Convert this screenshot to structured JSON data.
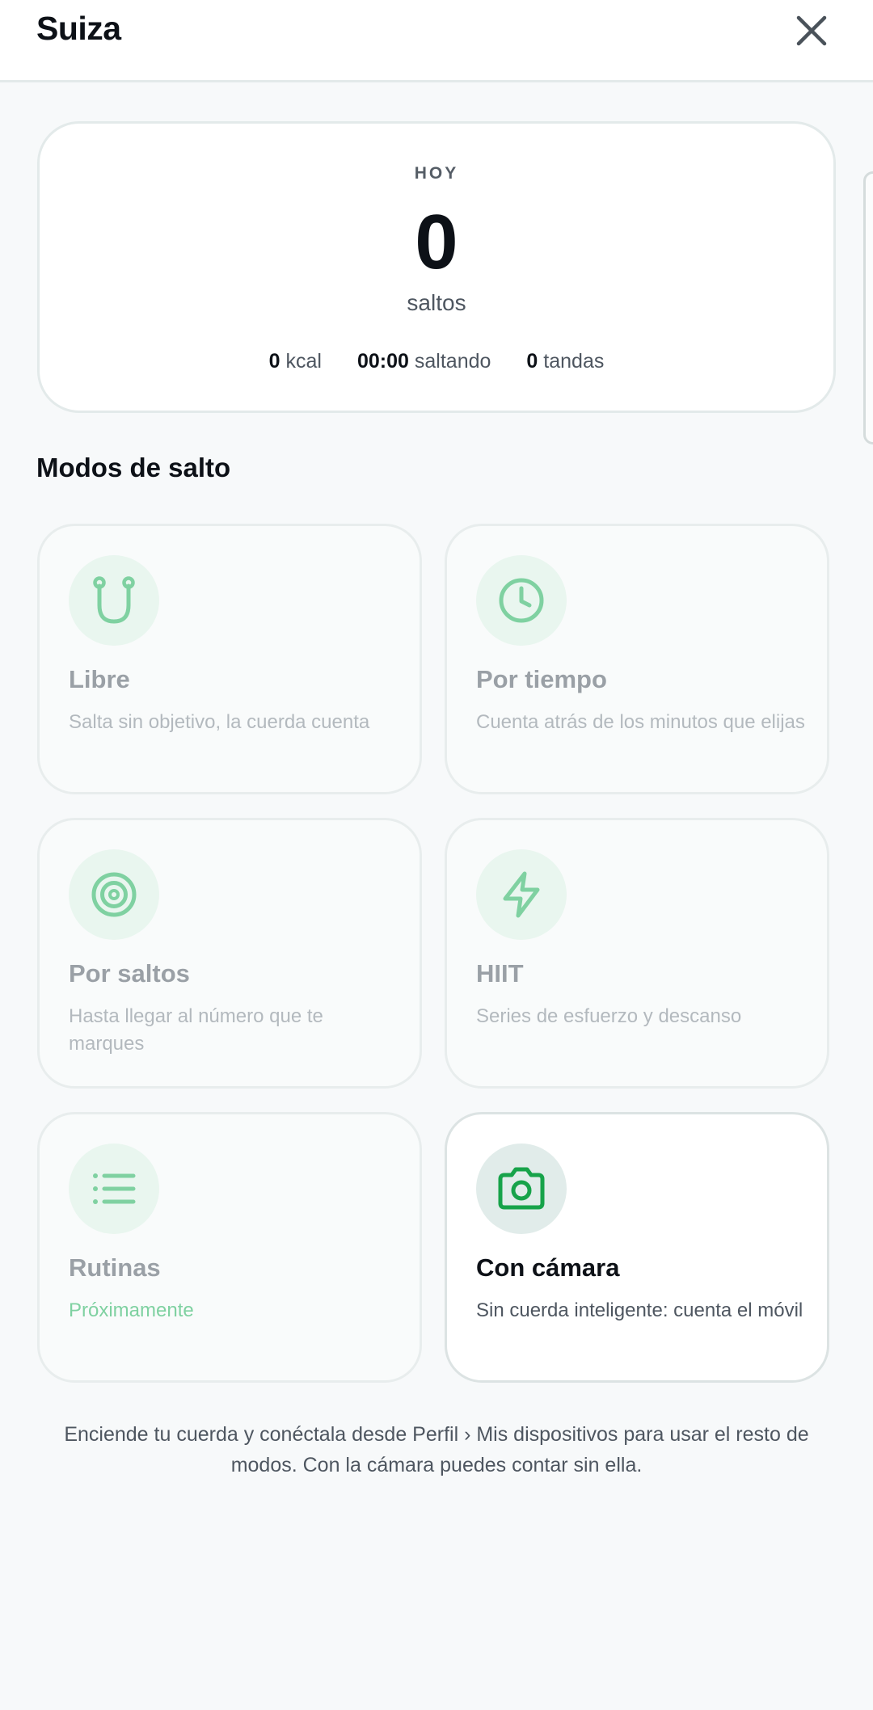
{
  "header": {
    "title": "Suiza",
    "close_icon": "close-icon"
  },
  "today": {
    "label": "HOY",
    "value": "0",
    "unit": "saltos",
    "stats": [
      {
        "value": "0",
        "label": "kcal"
      },
      {
        "value": "00:00",
        "label": "saltando"
      },
      {
        "value": "0",
        "label": "tandas"
      }
    ]
  },
  "modes_section": {
    "title": "Modos de salto",
    "modes": [
      {
        "icon": "rope-icon",
        "title": "Libre",
        "description": "Salta sin objetivo, la cuerda cuenta"
      },
      {
        "icon": "clock-icon",
        "title": "Por tiempo",
        "description": "Cuenta atrás de los minutos que elijas"
      },
      {
        "icon": "target-icon",
        "title": "Por saltos",
        "description": "Hasta llegar al número que te marques"
      },
      {
        "icon": "lightning-icon",
        "title": "HIIT",
        "description": "Series de esfuerzo y descanso"
      },
      {
        "icon": "list-icon",
        "title": "Rutinas",
        "description": "Próximamente"
      },
      {
        "icon": "camera-icon",
        "title": "Con cámara",
        "description": "Sin cuerda inteligente: cuenta el móvil"
      }
    ]
  },
  "footer": {
    "note": "Enciende tu cuerda y conéctala desde Perfil › Mis dispositivos para usar el resto de modos. Con la cámara puedes contar sin ella."
  },
  "colors": {
    "accent_green": "#5cc98c",
    "camera_green": "#17a34a",
    "soon_text": "#7fd1a1"
  }
}
